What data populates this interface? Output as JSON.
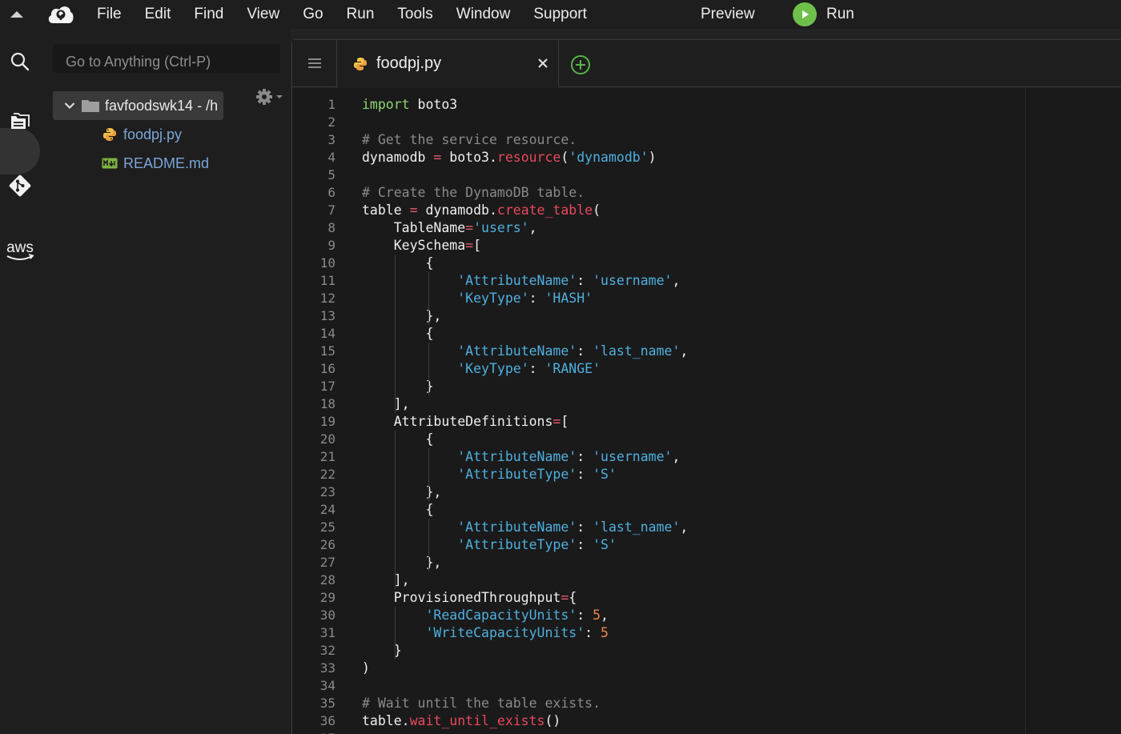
{
  "menubar": {
    "items": [
      "File",
      "Edit",
      "Find",
      "View",
      "Go",
      "Run",
      "Tools",
      "Window",
      "Support"
    ],
    "preview_label": "Preview",
    "run_label": "Run"
  },
  "sidebar": {
    "goto_placeholder": "Go to Anything (Ctrl-P)",
    "root_label": "favfoodswk14 - /h",
    "files": [
      {
        "name": "foodpj.py",
        "icon": "python-file-icon"
      },
      {
        "name": "README.md",
        "icon": "markdown-file-icon"
      }
    ]
  },
  "editor": {
    "tab_label": "foodpj.py",
    "lines": [
      [
        [
          "kw",
          "import"
        ],
        [
          "id",
          " boto3"
        ]
      ],
      [],
      [
        [
          "cm",
          "# Get the service resource."
        ]
      ],
      [
        [
          "id",
          "dynamodb "
        ],
        [
          "op",
          "="
        ],
        [
          "id",
          " boto3."
        ],
        [
          "fn",
          "resource"
        ],
        [
          "id",
          "("
        ],
        [
          "st",
          "'dynamodb'"
        ],
        [
          "id",
          ")"
        ]
      ],
      [],
      [
        [
          "cm",
          "# Create the DynamoDB table."
        ]
      ],
      [
        [
          "id",
          "table "
        ],
        [
          "op",
          "="
        ],
        [
          "id",
          " dynamodb."
        ],
        [
          "fn",
          "create_table"
        ],
        [
          "id",
          "("
        ]
      ],
      [
        [
          "id",
          "    TableName"
        ],
        [
          "op",
          "="
        ],
        [
          "st",
          "'users'"
        ],
        [
          "id",
          ","
        ]
      ],
      [
        [
          "id",
          "    KeySchema"
        ],
        [
          "op",
          "="
        ],
        [
          "id",
          "["
        ]
      ],
      [
        [
          "id",
          "        {"
        ]
      ],
      [
        [
          "id",
          "            "
        ],
        [
          "st",
          "'AttributeName'"
        ],
        [
          "id",
          ": "
        ],
        [
          "st",
          "'username'"
        ],
        [
          "id",
          ","
        ]
      ],
      [
        [
          "id",
          "            "
        ],
        [
          "st",
          "'KeyType'"
        ],
        [
          "id",
          ": "
        ],
        [
          "st",
          "'HASH'"
        ]
      ],
      [
        [
          "id",
          "        },"
        ]
      ],
      [
        [
          "id",
          "        {"
        ]
      ],
      [
        [
          "id",
          "            "
        ],
        [
          "st",
          "'AttributeName'"
        ],
        [
          "id",
          ": "
        ],
        [
          "st",
          "'last_name'"
        ],
        [
          "id",
          ","
        ]
      ],
      [
        [
          "id",
          "            "
        ],
        [
          "st",
          "'KeyType'"
        ],
        [
          "id",
          ": "
        ],
        [
          "st",
          "'RANGE'"
        ]
      ],
      [
        [
          "id",
          "        }"
        ]
      ],
      [
        [
          "id",
          "    ],"
        ]
      ],
      [
        [
          "id",
          "    AttributeDefinitions"
        ],
        [
          "op",
          "="
        ],
        [
          "id",
          "["
        ]
      ],
      [
        [
          "id",
          "        {"
        ]
      ],
      [
        [
          "id",
          "            "
        ],
        [
          "st",
          "'AttributeName'"
        ],
        [
          "id",
          ": "
        ],
        [
          "st",
          "'username'"
        ],
        [
          "id",
          ","
        ]
      ],
      [
        [
          "id",
          "            "
        ],
        [
          "st",
          "'AttributeType'"
        ],
        [
          "id",
          ": "
        ],
        [
          "st",
          "'S'"
        ]
      ],
      [
        [
          "id",
          "        },"
        ]
      ],
      [
        [
          "id",
          "        {"
        ]
      ],
      [
        [
          "id",
          "            "
        ],
        [
          "st",
          "'AttributeName'"
        ],
        [
          "id",
          ": "
        ],
        [
          "st",
          "'last_name'"
        ],
        [
          "id",
          ","
        ]
      ],
      [
        [
          "id",
          "            "
        ],
        [
          "st",
          "'AttributeType'"
        ],
        [
          "id",
          ": "
        ],
        [
          "st",
          "'S'"
        ]
      ],
      [
        [
          "id",
          "        },"
        ]
      ],
      [
        [
          "id",
          "    ],"
        ]
      ],
      [
        [
          "id",
          "    ProvisionedThroughput"
        ],
        [
          "op",
          "="
        ],
        [
          "id",
          "{"
        ]
      ],
      [
        [
          "id",
          "        "
        ],
        [
          "st",
          "'ReadCapacityUnits'"
        ],
        [
          "id",
          ": "
        ],
        [
          "nm",
          "5"
        ],
        [
          "id",
          ","
        ]
      ],
      [
        [
          "id",
          "        "
        ],
        [
          "st",
          "'WriteCapacityUnits'"
        ],
        [
          "id",
          ": "
        ],
        [
          "nm",
          "5"
        ]
      ],
      [
        [
          "id",
          "    }"
        ]
      ],
      [
        [
          "id",
          ")"
        ]
      ],
      [],
      [
        [
          "cm",
          "# Wait until the table exists."
        ]
      ],
      [
        [
          "id",
          "table."
        ],
        [
          "fn",
          "wait_until_exists"
        ],
        [
          "id",
          "()"
        ]
      ],
      []
    ]
  }
}
